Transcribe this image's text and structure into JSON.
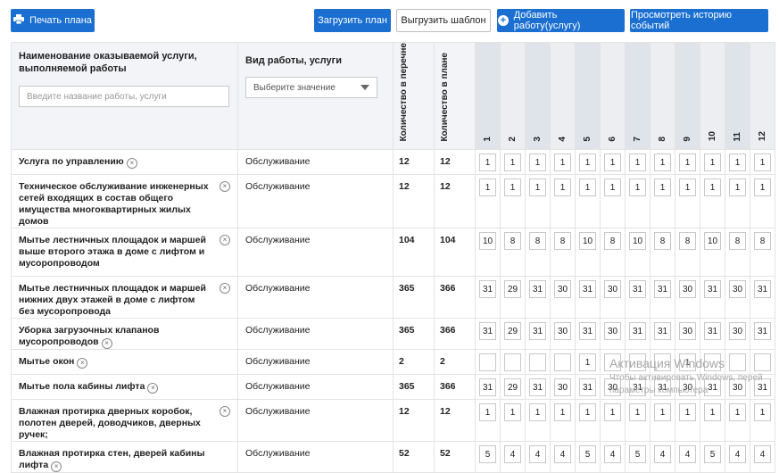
{
  "toolbar": {
    "print_label": "Печать плана",
    "upload_label": "Загрузить план",
    "download_template_label": "Выгрузить шаблон",
    "add_work_label": "Добавить работу(услугу)",
    "history_label": "Просмотреть историю событий"
  },
  "table": {
    "headers": {
      "name": "Наименование оказываемой услуги, выполняемой работы",
      "kind": "Вид работы, услуги",
      "qty_list": "Количество в перечне",
      "qty_plan": "Количество в плане",
      "months": [
        "1",
        "2",
        "3",
        "4",
        "5",
        "6",
        "7",
        "8",
        "9",
        "10",
        "11",
        "12"
      ]
    },
    "filters": {
      "name_placeholder": "Введите название работы, услуги",
      "kind_value": "Выберите значение"
    },
    "rows": [
      {
        "name": "Услуга по управлению",
        "kind": "Обслуживание",
        "qty_list": "12",
        "qty_plan": "12",
        "months": [
          "1",
          "1",
          "1",
          "1",
          "1",
          "1",
          "1",
          "1",
          "1",
          "1",
          "1",
          "1"
        ]
      },
      {
        "name": "Техническое обслуживание инженерных сетей входящих в состав общего имущества многоквартирных жилых домов",
        "kind": "Обслуживание",
        "qty_list": "12",
        "qty_plan": "12",
        "months": [
          "1",
          "1",
          "1",
          "1",
          "1",
          "1",
          "1",
          "1",
          "1",
          "1",
          "1",
          "1"
        ]
      },
      {
        "name": "Мытье лестничных площадок и маршей выше второго этажа в доме с лифтом и мусоропроводом",
        "kind": "Обслуживание",
        "qty_list": "104",
        "qty_plan": "104",
        "months": [
          "10",
          "8",
          "8",
          "8",
          "10",
          "8",
          "10",
          "8",
          "8",
          "10",
          "8",
          "8"
        ]
      },
      {
        "name": "Мытье лестничных площадок и маршей нижних двух этажей в доме с лифтом без мусоропровода",
        "kind": "Обслуживание",
        "qty_list": "365",
        "qty_plan": "366",
        "months": [
          "31",
          "29",
          "31",
          "30",
          "31",
          "30",
          "31",
          "31",
          "30",
          "31",
          "30",
          "31"
        ]
      },
      {
        "name": "Уборка загрузочных клапанов мусоропроводов",
        "kind": "Обслуживание",
        "qty_list": "365",
        "qty_plan": "366",
        "months": [
          "31",
          "29",
          "31",
          "30",
          "31",
          "30",
          "31",
          "31",
          "30",
          "31",
          "30",
          "31"
        ]
      },
      {
        "name": "Мытье окон",
        "kind": "Обслуживание",
        "qty_list": "2",
        "qty_plan": "2",
        "months": [
          "",
          "",
          "",
          "",
          "1",
          "",
          "",
          "",
          "1",
          "",
          "",
          ""
        ]
      },
      {
        "name": "Мытье пола кабины лифта",
        "kind": "Обслуживание",
        "qty_list": "365",
        "qty_plan": "366",
        "months": [
          "31",
          "29",
          "31",
          "30",
          "31",
          "30",
          "31",
          "31",
          "30",
          "31",
          "30",
          "31"
        ]
      },
      {
        "name": "Влажная протирка дверных коробок, полотен дверей, доводчиков, дверных ручек;",
        "kind": "Обслуживание",
        "qty_list": "12",
        "qty_plan": "12",
        "months": [
          "1",
          "1",
          "1",
          "1",
          "1",
          "1",
          "1",
          "1",
          "1",
          "1",
          "1",
          "1"
        ]
      },
      {
        "name": "Влажная протирка стен, дверей кабины лифта",
        "kind": "Обслуживание",
        "qty_list": "52",
        "qty_plan": "52",
        "months": [
          "5",
          "4",
          "4",
          "4",
          "5",
          "4",
          "5",
          "4",
          "4",
          "5",
          "4",
          "4"
        ]
      }
    ]
  },
  "watermark": {
    "line1": "Активация Windows",
    "line2": "Чтобы активировать Windows, перей",
    "line3": "параметры компьютера"
  }
}
